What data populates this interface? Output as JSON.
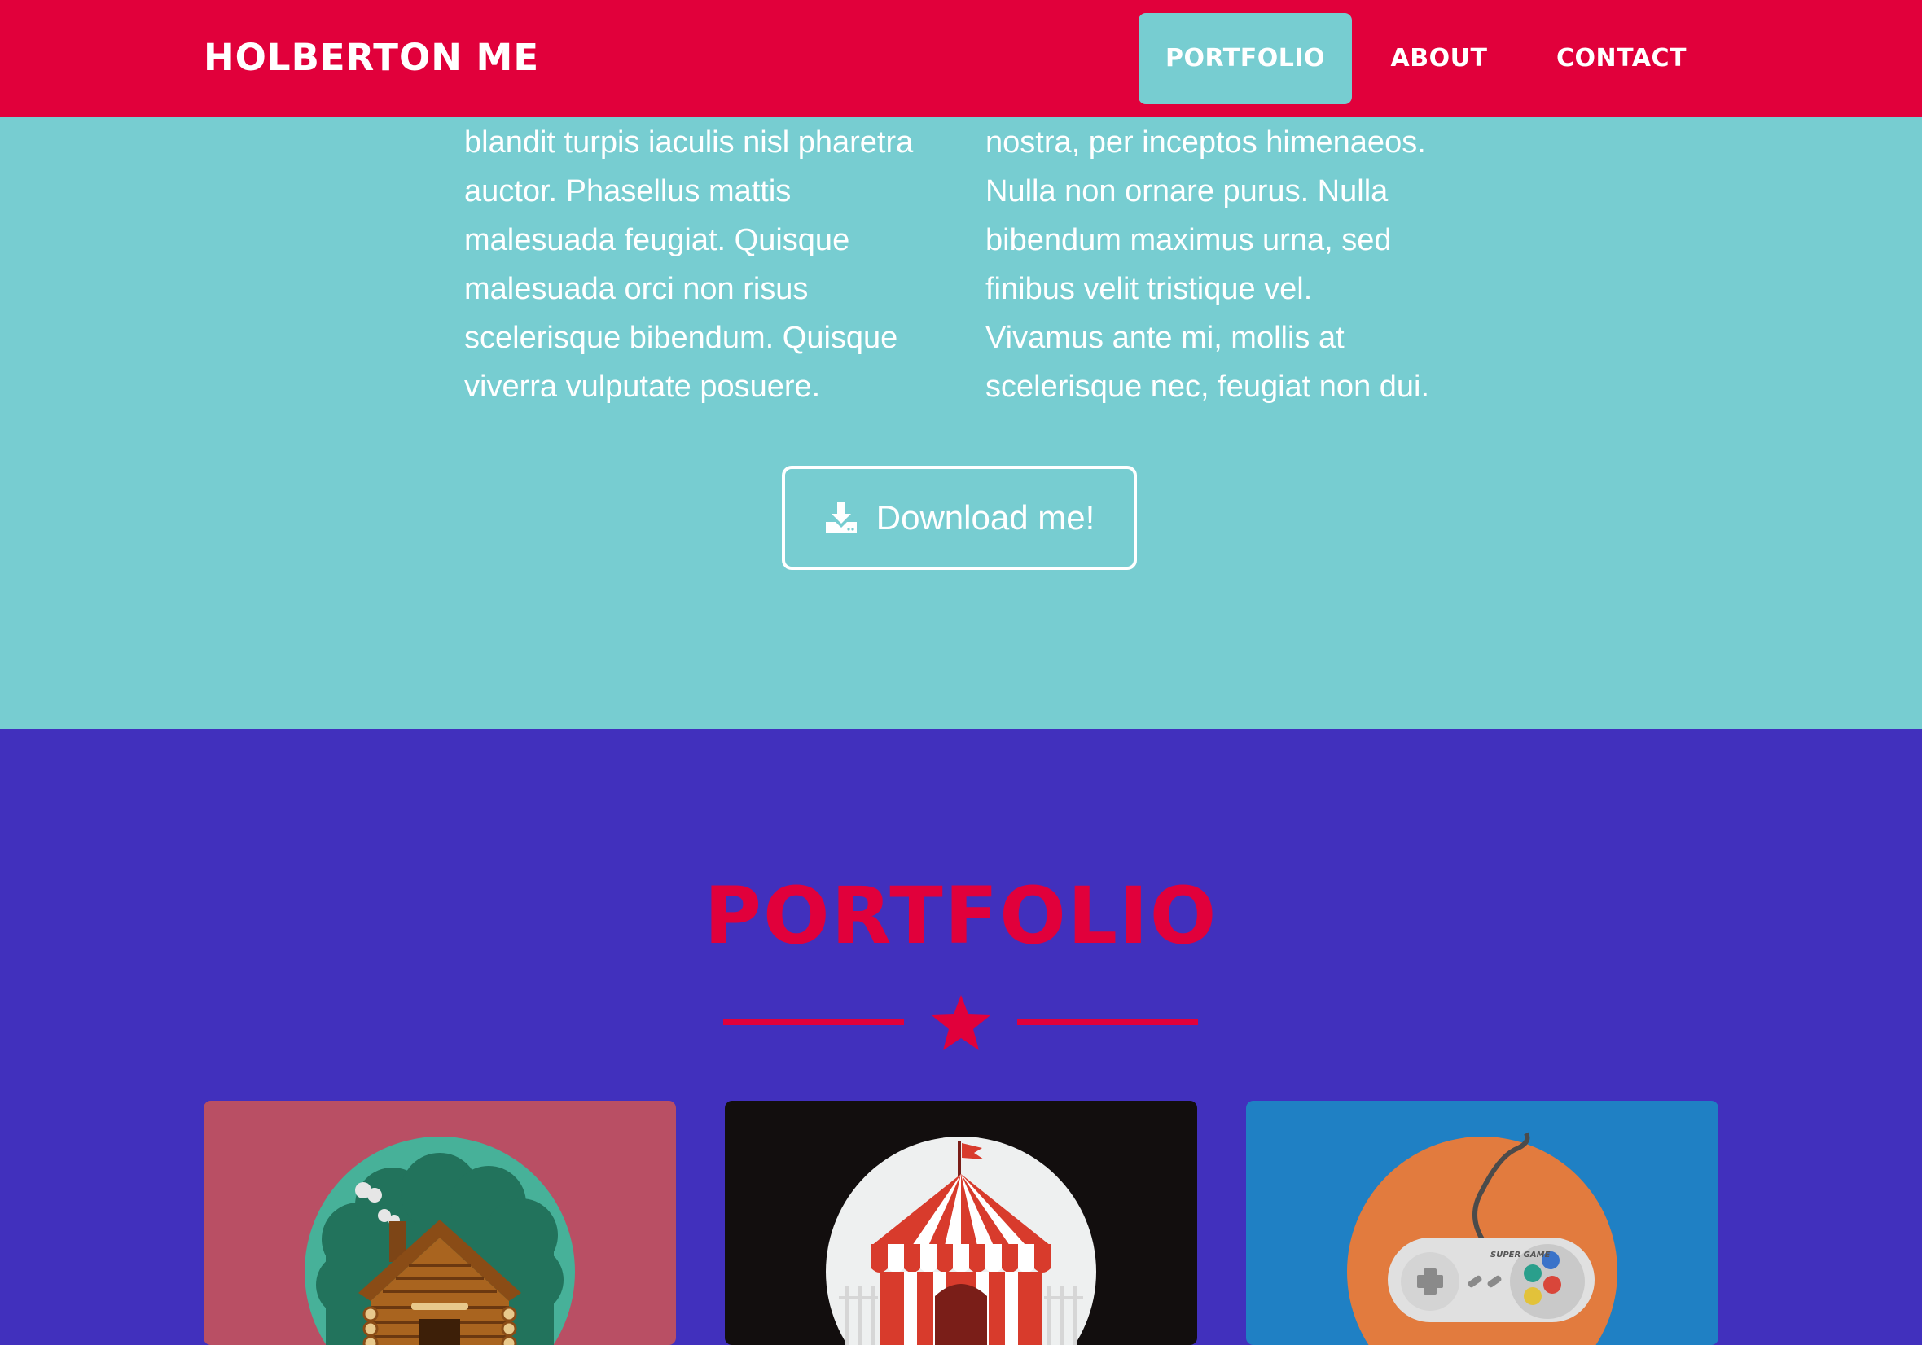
{
  "navbar": {
    "brand": "HOLBERTON ME",
    "items": [
      {
        "label": "PORTFOLIO",
        "active": true
      },
      {
        "label": "ABOUT",
        "active": false
      },
      {
        "label": "CONTACT",
        "active": false
      }
    ]
  },
  "about": {
    "left_lines": [
      "blandit turpis iaculis nisl pharetra",
      "auctor. Phasellus mattis",
      "malesuada feugiat. Quisque",
      "malesuada orci non risus",
      "scelerisque bibendum. Quisque",
      "viverra vulputate posuere."
    ],
    "right_lines": [
      "nostra, per inceptos himenaeos.",
      "Nulla non ornare purus. Nulla",
      "bibendum maximus urna, sed",
      "finibus velit tristique vel.",
      "Vivamus ante mi, mollis at",
      "scelerisque nec, feugiat non dui."
    ],
    "download_label": "Download me!"
  },
  "portfolio": {
    "title": "PORTFOLIO",
    "cards": [
      {
        "name": "cabin",
        "bg": "#b94f64"
      },
      {
        "name": "circus-tent",
        "bg": "#120e0e"
      },
      {
        "name": "game-controller",
        "bg": "#1f80c4",
        "controller_text": "SUPER GAME"
      }
    ]
  },
  "colors": {
    "navbar": "#e1003b",
    "about_bg": "#77cdd1",
    "portfolio_bg": "#4130bd",
    "accent": "#e1003b"
  }
}
